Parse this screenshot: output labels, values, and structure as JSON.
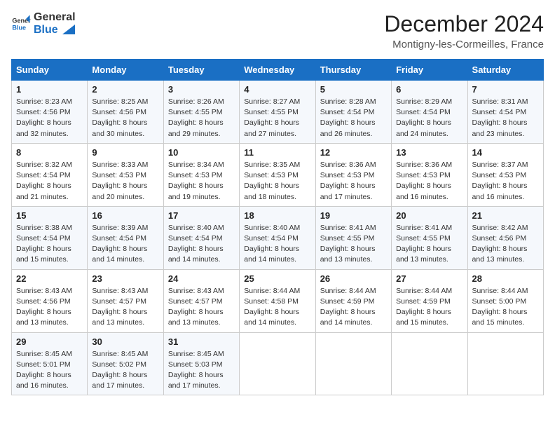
{
  "logo": {
    "text_general": "General",
    "text_blue": "Blue"
  },
  "header": {
    "month": "December 2024",
    "location": "Montigny-les-Cormeilles, France"
  },
  "days_of_week": [
    "Sunday",
    "Monday",
    "Tuesday",
    "Wednesday",
    "Thursday",
    "Friday",
    "Saturday"
  ],
  "weeks": [
    [
      {
        "day": "1",
        "sunrise": "8:23 AM",
        "sunset": "4:56 PM",
        "daylight": "8 hours and 32 minutes."
      },
      {
        "day": "2",
        "sunrise": "8:25 AM",
        "sunset": "4:56 PM",
        "daylight": "8 hours and 30 minutes."
      },
      {
        "day": "3",
        "sunrise": "8:26 AM",
        "sunset": "4:55 PM",
        "daylight": "8 hours and 29 minutes."
      },
      {
        "day": "4",
        "sunrise": "8:27 AM",
        "sunset": "4:55 PM",
        "daylight": "8 hours and 27 minutes."
      },
      {
        "day": "5",
        "sunrise": "8:28 AM",
        "sunset": "4:54 PM",
        "daylight": "8 hours and 26 minutes."
      },
      {
        "day": "6",
        "sunrise": "8:29 AM",
        "sunset": "4:54 PM",
        "daylight": "8 hours and 24 minutes."
      },
      {
        "day": "7",
        "sunrise": "8:31 AM",
        "sunset": "4:54 PM",
        "daylight": "8 hours and 23 minutes."
      }
    ],
    [
      {
        "day": "8",
        "sunrise": "8:32 AM",
        "sunset": "4:54 PM",
        "daylight": "8 hours and 21 minutes."
      },
      {
        "day": "9",
        "sunrise": "8:33 AM",
        "sunset": "4:53 PM",
        "daylight": "8 hours and 20 minutes."
      },
      {
        "day": "10",
        "sunrise": "8:34 AM",
        "sunset": "4:53 PM",
        "daylight": "8 hours and 19 minutes."
      },
      {
        "day": "11",
        "sunrise": "8:35 AM",
        "sunset": "4:53 PM",
        "daylight": "8 hours and 18 minutes."
      },
      {
        "day": "12",
        "sunrise": "8:36 AM",
        "sunset": "4:53 PM",
        "daylight": "8 hours and 17 minutes."
      },
      {
        "day": "13",
        "sunrise": "8:36 AM",
        "sunset": "4:53 PM",
        "daylight": "8 hours and 16 minutes."
      },
      {
        "day": "14",
        "sunrise": "8:37 AM",
        "sunset": "4:53 PM",
        "daylight": "8 hours and 16 minutes."
      }
    ],
    [
      {
        "day": "15",
        "sunrise": "8:38 AM",
        "sunset": "4:54 PM",
        "daylight": "8 hours and 15 minutes."
      },
      {
        "day": "16",
        "sunrise": "8:39 AM",
        "sunset": "4:54 PM",
        "daylight": "8 hours and 14 minutes."
      },
      {
        "day": "17",
        "sunrise": "8:40 AM",
        "sunset": "4:54 PM",
        "daylight": "8 hours and 14 minutes."
      },
      {
        "day": "18",
        "sunrise": "8:40 AM",
        "sunset": "4:54 PM",
        "daylight": "8 hours and 14 minutes."
      },
      {
        "day": "19",
        "sunrise": "8:41 AM",
        "sunset": "4:55 PM",
        "daylight": "8 hours and 13 minutes."
      },
      {
        "day": "20",
        "sunrise": "8:41 AM",
        "sunset": "4:55 PM",
        "daylight": "8 hours and 13 minutes."
      },
      {
        "day": "21",
        "sunrise": "8:42 AM",
        "sunset": "4:56 PM",
        "daylight": "8 hours and 13 minutes."
      }
    ],
    [
      {
        "day": "22",
        "sunrise": "8:43 AM",
        "sunset": "4:56 PM",
        "daylight": "8 hours and 13 minutes."
      },
      {
        "day": "23",
        "sunrise": "8:43 AM",
        "sunset": "4:57 PM",
        "daylight": "8 hours and 13 minutes."
      },
      {
        "day": "24",
        "sunrise": "8:43 AM",
        "sunset": "4:57 PM",
        "daylight": "8 hours and 13 minutes."
      },
      {
        "day": "25",
        "sunrise": "8:44 AM",
        "sunset": "4:58 PM",
        "daylight": "8 hours and 14 minutes."
      },
      {
        "day": "26",
        "sunrise": "8:44 AM",
        "sunset": "4:59 PM",
        "daylight": "8 hours and 14 minutes."
      },
      {
        "day": "27",
        "sunrise": "8:44 AM",
        "sunset": "4:59 PM",
        "daylight": "8 hours and 15 minutes."
      },
      {
        "day": "28",
        "sunrise": "8:44 AM",
        "sunset": "5:00 PM",
        "daylight": "8 hours and 15 minutes."
      }
    ],
    [
      {
        "day": "29",
        "sunrise": "8:45 AM",
        "sunset": "5:01 PM",
        "daylight": "8 hours and 16 minutes."
      },
      {
        "day": "30",
        "sunrise": "8:45 AM",
        "sunset": "5:02 PM",
        "daylight": "8 hours and 17 minutes."
      },
      {
        "day": "31",
        "sunrise": "8:45 AM",
        "sunset": "5:03 PM",
        "daylight": "8 hours and 17 minutes."
      },
      null,
      null,
      null,
      null
    ]
  ]
}
